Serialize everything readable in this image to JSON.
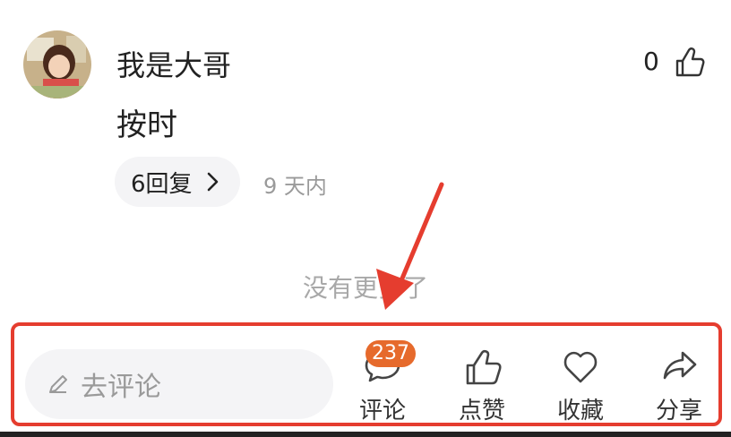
{
  "comment": {
    "username": "我是大哥",
    "like_count": "0",
    "text": "按时",
    "replies_label": "6回复",
    "time": "9 天内"
  },
  "footer_notice": "没有更多了",
  "bottom_bar": {
    "input_placeholder": "去评论",
    "comment_badge": "237",
    "actions": [
      {
        "label": "评论",
        "icon": "comment-icon"
      },
      {
        "label": "点赞",
        "icon": "thumbs-up-icon"
      },
      {
        "label": "收藏",
        "icon": "heart-icon"
      },
      {
        "label": "分享",
        "icon": "share-icon"
      }
    ]
  },
  "colors": {
    "highlight": "#e53d2f",
    "badge": "#e66a2c",
    "muted": "#9a9a9a"
  }
}
